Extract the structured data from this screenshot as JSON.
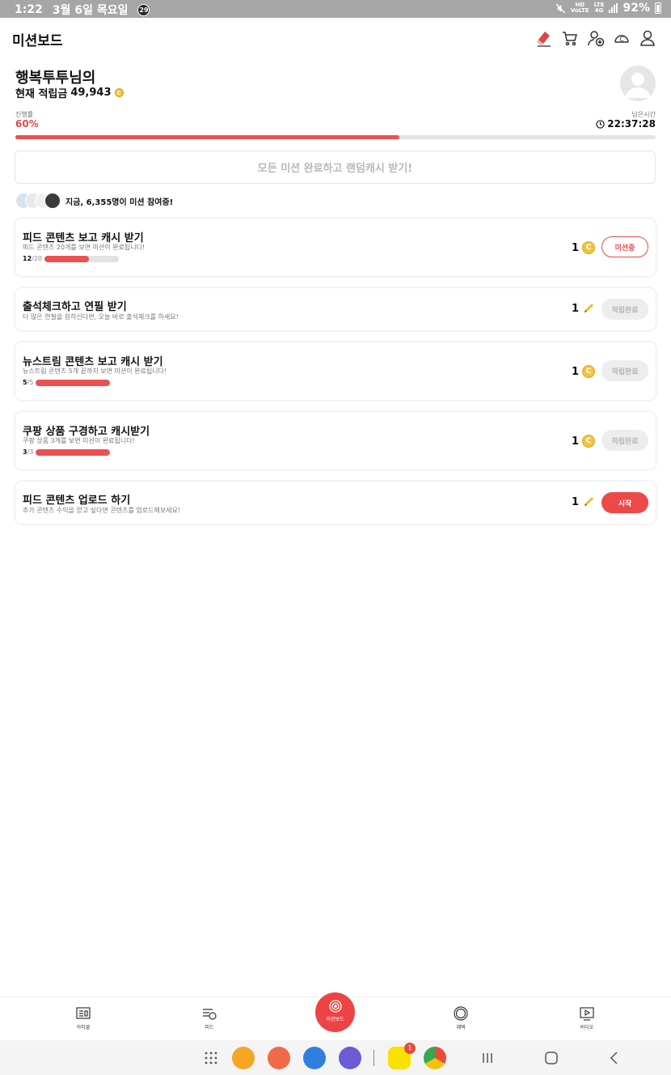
{
  "status_bar": {
    "time": "1:22",
    "date": "3월 6일 목요일",
    "notif_count": "29",
    "hd": "HD",
    "voice": "VoLTE",
    "lte": "LTE",
    "lte2": "4G",
    "battery": "92%"
  },
  "app_bar": {
    "title": "미션보드",
    "icons": [
      "eraser-icon",
      "cart-icon",
      "add-friend-icon",
      "cash-icon",
      "profile-icon"
    ]
  },
  "profile": {
    "name": "행복투투님의",
    "points_label": "현재 적립금",
    "points_value": "49,943",
    "coin_symbol": "C"
  },
  "progress": {
    "label": "진행률",
    "value_text": "60%",
    "fraction": 0.6,
    "remaining_label": "남은시간",
    "remaining_time": "22:37:28"
  },
  "all_missions_text": "모든 미션 완료하고 랜덤캐시 받기!",
  "participants_text": "지금, 6,355명이 미션 참여중!",
  "missions": [
    {
      "title": "피드 콘텐츠 보고 캐시 받기",
      "desc": "피드 콘텐츠 20개를 보면 미션이 완료됩니다!",
      "done": "12",
      "total": "/20",
      "fraction": 0.6,
      "reward": "1",
      "reward_icon": "coin-icon",
      "button": "미션중"
    },
    {
      "title": "출석체크하고 연필 받기",
      "desc": "더 많은 연필을 원하신다면, 오늘 바로 출석체크를 하세요!",
      "reward": "1",
      "reward_icon": "pencil-icon",
      "button": "적립완료"
    },
    {
      "title": "뉴스트림 콘텐츠 보고 캐시 받기",
      "desc": "뉴스트림 콘텐츠 5개 끝까지 보면 미션이 완료됩니다!",
      "done": "5",
      "total": "/5",
      "fraction": 1.0,
      "reward": "1",
      "reward_icon": "coin-icon",
      "button": "적립완료"
    },
    {
      "title": "쿠팡 상품 구경하고 캐시받기",
      "desc": "쿠팡 상품 3개를 보면 미션이 완료됩니다!",
      "done": "3",
      "total": "/3",
      "fraction": 1.0,
      "reward": "1",
      "reward_icon": "coin-icon",
      "button": "적립완료"
    },
    {
      "title": "피드 콘텐츠 업로드 하기",
      "desc": "추가 콘텐츠 수익을 얻고 싶다면 콘텐츠를 업로드해보세요!",
      "reward": "1",
      "reward_icon": "pencil-icon",
      "button": "시작"
    }
  ],
  "bottom_nav": {
    "article": "아티클",
    "feed": "피드",
    "missionboard": "미션보드",
    "benefit": "혜택",
    "video": "비디오"
  },
  "colors": {
    "accent": "#ec5050",
    "coin": "#f2c43a",
    "status_bar": "#a6a6a6"
  },
  "sys_nav": {
    "kakao_badge": "1"
  }
}
